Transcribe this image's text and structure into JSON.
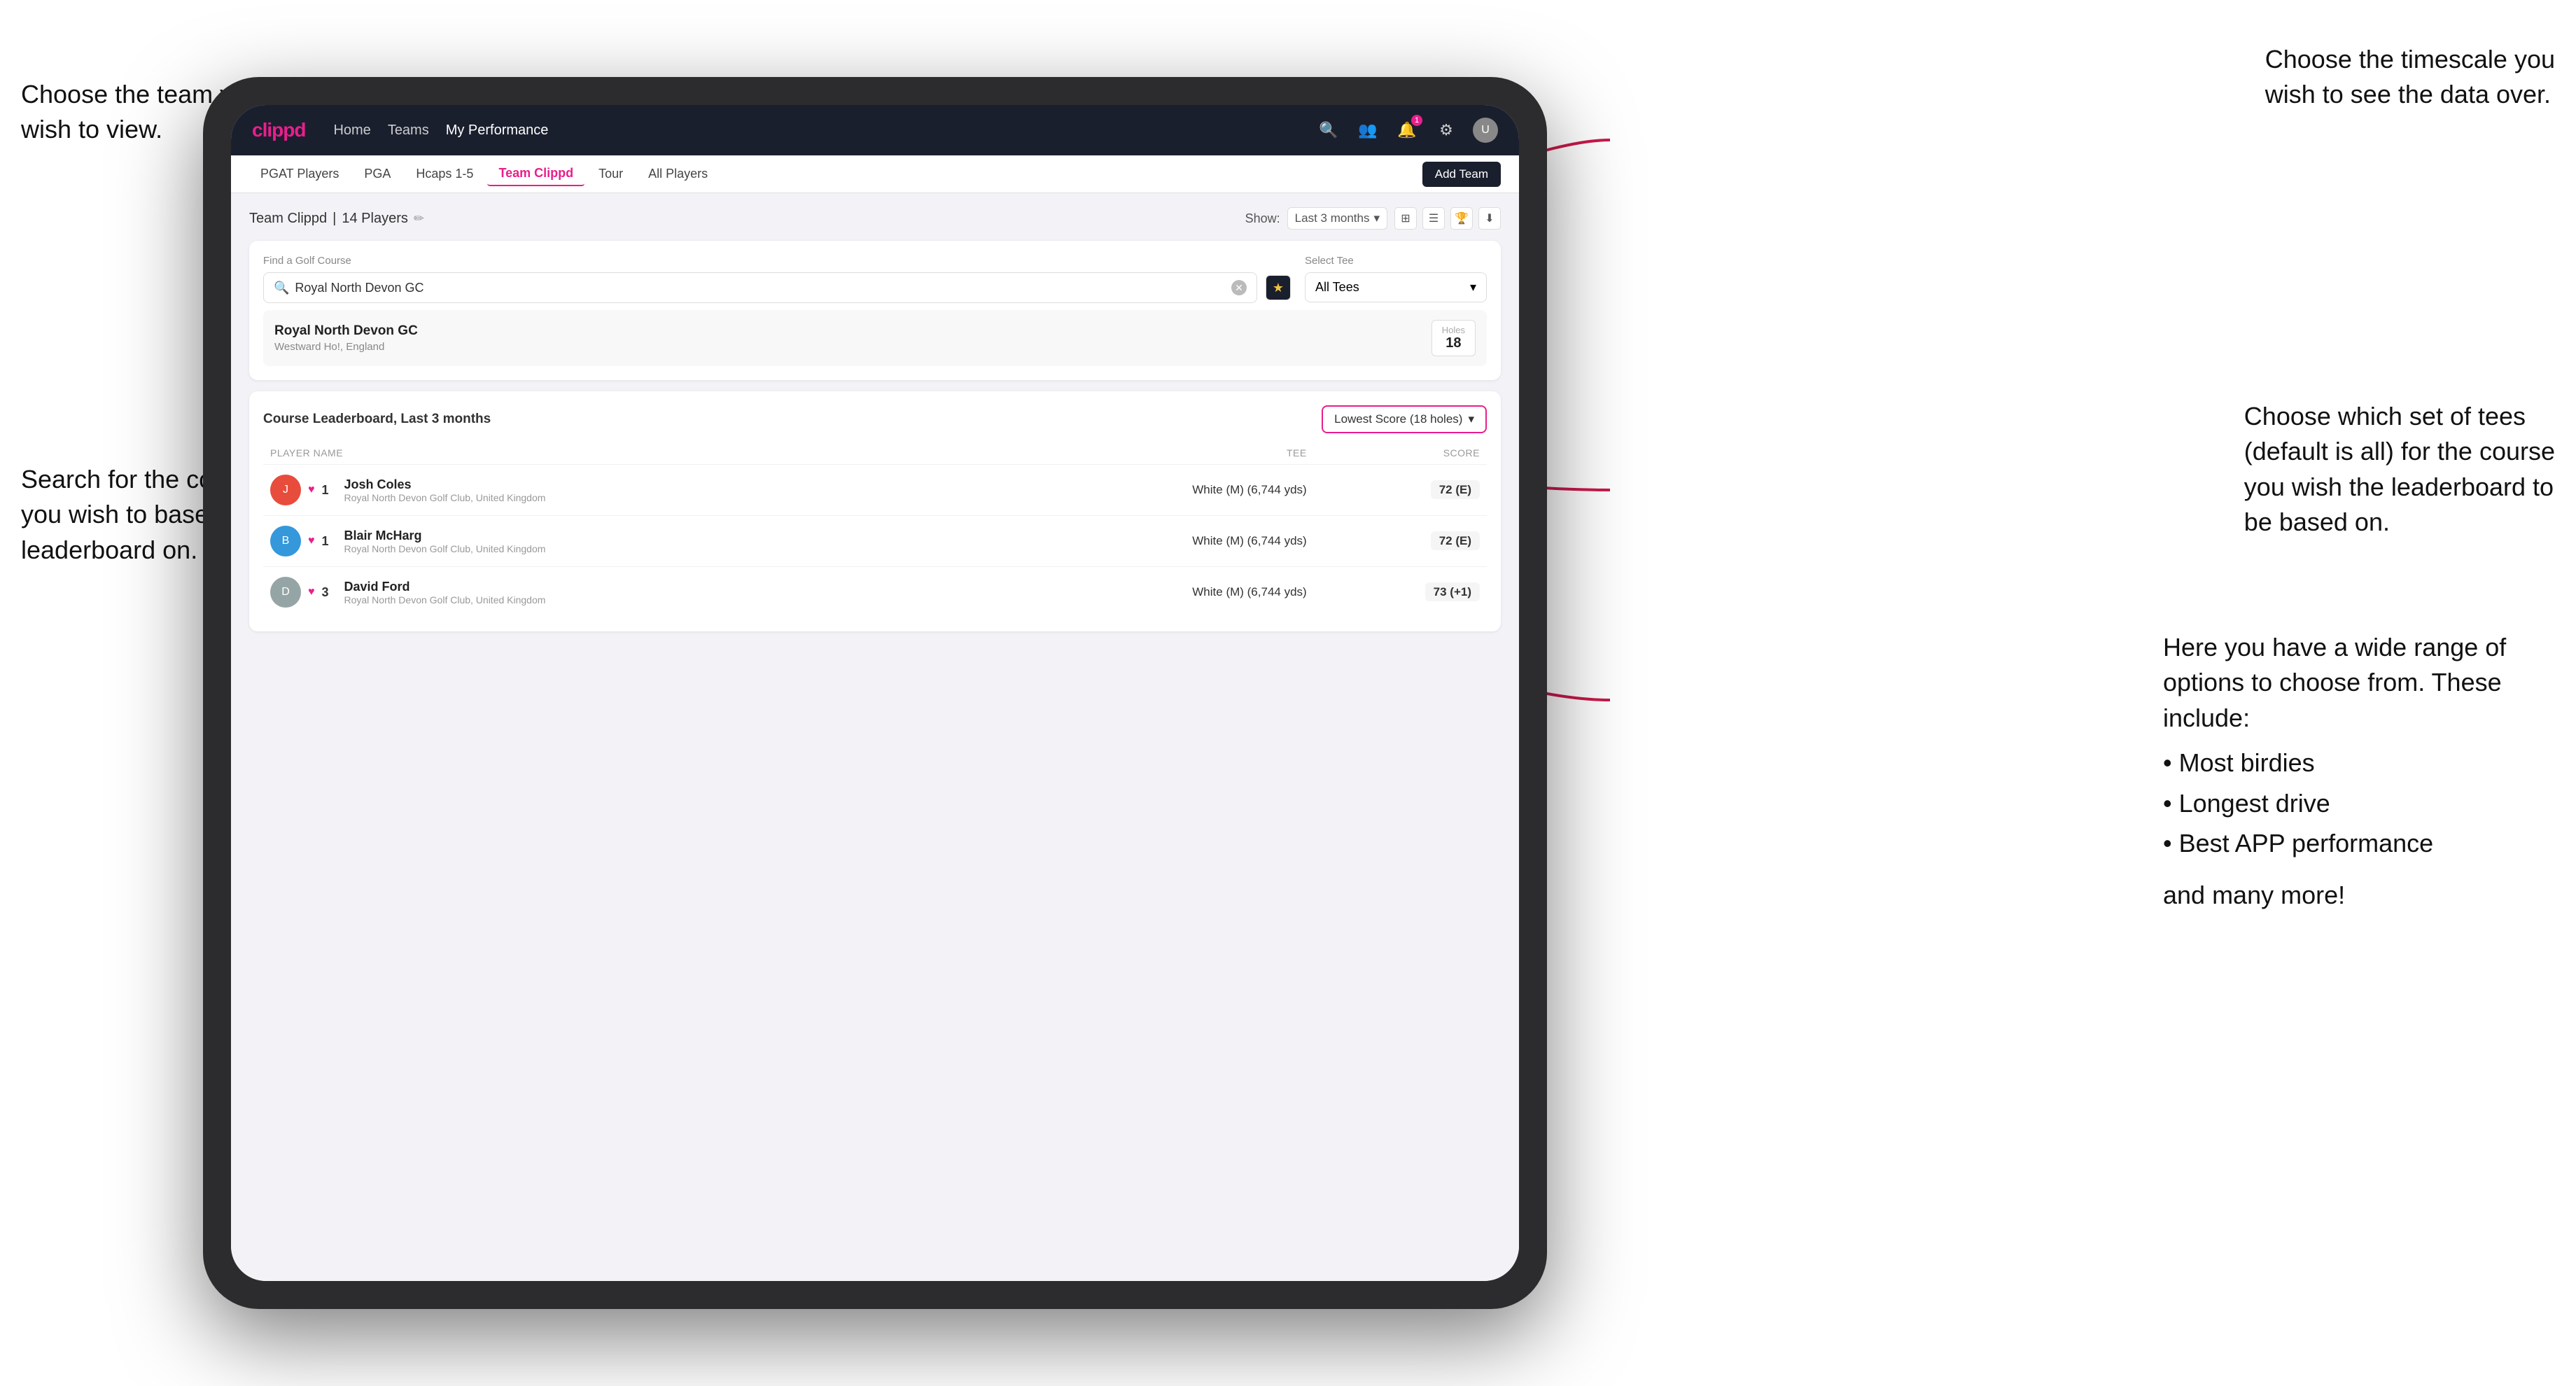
{
  "annotations": {
    "top_left": {
      "line1": "Choose the team you",
      "line2": "wish to view."
    },
    "mid_left": {
      "line1": "Search for the course",
      "line2": "you wish to base the",
      "line3": "leaderboard on."
    },
    "top_right": {
      "line1": "Choose the timescale you",
      "line2": "wish to see the data over."
    },
    "mid_right": {
      "line1": "Choose which set of tees",
      "line2": "(default is all) for the course",
      "line3": "you wish the leaderboard to",
      "line4": "be based on."
    },
    "bottom_right": {
      "intro": "Here you have a wide range of options to choose from. These include:",
      "bullets": [
        "Most birdies",
        "Longest drive",
        "Best APP performance"
      ],
      "outro": "and many more!"
    }
  },
  "nav": {
    "logo": "clippd",
    "links": [
      "Home",
      "Teams",
      "My Performance"
    ],
    "active_link": "My Performance"
  },
  "sub_nav": {
    "tabs": [
      "PGAT Players",
      "PGA",
      "Hcaps 1-5",
      "Team Clippd",
      "Tour",
      "All Players"
    ],
    "active_tab": "Team Clippd",
    "add_team_label": "Add Team"
  },
  "team_header": {
    "title": "Team Clippd",
    "player_count": "14 Players",
    "show_label": "Show:",
    "time_filter": "Last 3 months"
  },
  "course_search": {
    "find_label": "Find a Golf Course",
    "search_value": "Royal North Devon GC",
    "select_tee_label": "Select Tee",
    "tee_value": "All Tees"
  },
  "course_result": {
    "name": "Royal North Devon GC",
    "location": "Westward Ho!, England",
    "holes_label": "Holes",
    "holes_value": "18"
  },
  "leaderboard": {
    "title": "Course Leaderboard,",
    "title_sub": "Last 3 months",
    "sort_label": "Lowest Score (18 holes)",
    "columns": {
      "player": "PLAYER NAME",
      "tee": "TEE",
      "score": "SCORE"
    },
    "players": [
      {
        "rank": "1",
        "name": "Josh Coles",
        "club": "Royal North Devon Golf Club, United Kingdom",
        "tee": "White (M) (6,744 yds)",
        "score": "72 (E)"
      },
      {
        "rank": "1",
        "name": "Blair McHarg",
        "club": "Royal North Devon Golf Club, United Kingdom",
        "tee": "White (M) (6,744 yds)",
        "score": "72 (E)"
      },
      {
        "rank": "3",
        "name": "David Ford",
        "club": "Royal North Devon Golf Club, United Kingdom",
        "tee": "White (M) (6,744 yds)",
        "score": "73 (+1)"
      }
    ]
  }
}
